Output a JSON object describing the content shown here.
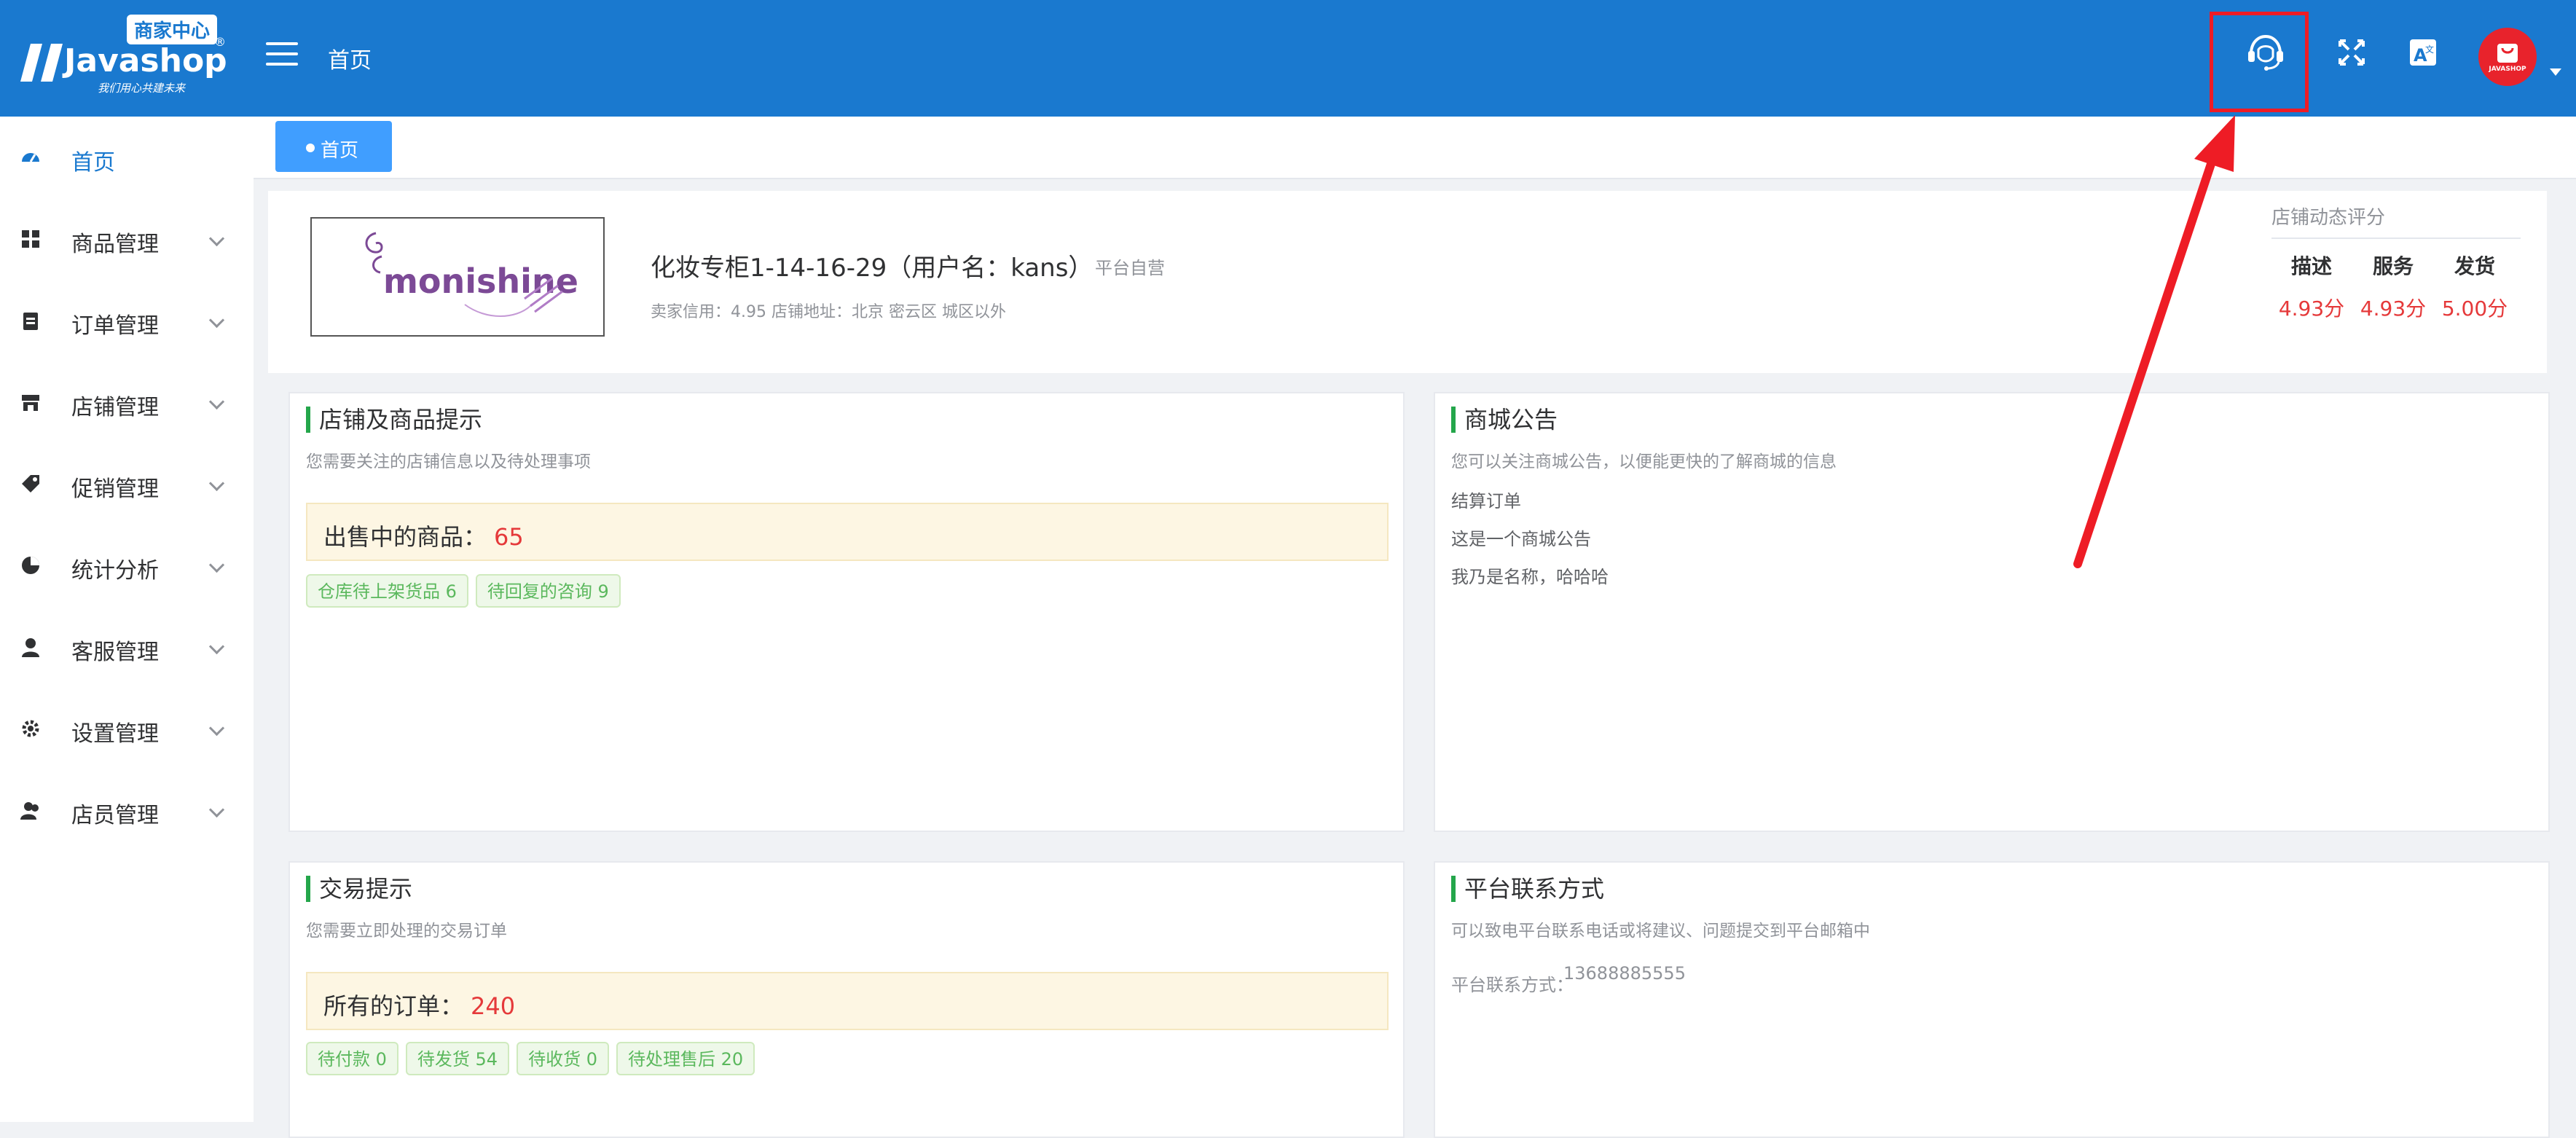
{
  "header": {
    "logo_badge": "商家中心",
    "logo_text": "Javashop",
    "logo_reg": "®",
    "logo_slogan": "我们用心共建未来",
    "title": "首页",
    "avatar_text": "JAVASHOP",
    "icons": [
      "customer-service-icon",
      "fullscreen-icon",
      "translate-icon"
    ],
    "colors": {
      "header_bg": "#1a79cf",
      "highlight": "#ee1c25",
      "avatar_bg": "#e8232c"
    }
  },
  "sidebar": {
    "items": [
      {
        "label": "首页",
        "icon": "dashboard-icon",
        "active": true,
        "expandable": false
      },
      {
        "label": "商品管理",
        "icon": "grid-icon",
        "expandable": true
      },
      {
        "label": "订单管理",
        "icon": "clipboard-icon",
        "expandable": true
      },
      {
        "label": "店铺管理",
        "icon": "store-icon",
        "expandable": true
      },
      {
        "label": "促销管理",
        "icon": "tag-icon",
        "expandable": true
      },
      {
        "label": "统计分析",
        "icon": "pie-chart-icon",
        "expandable": true
      },
      {
        "label": "客服管理",
        "icon": "user-icon",
        "expandable": true
      },
      {
        "label": "设置管理",
        "icon": "gear-icon",
        "expandable": true
      },
      {
        "label": "店员管理",
        "icon": "team-icon",
        "expandable": true
      }
    ]
  },
  "tabs": [
    {
      "label": "首页",
      "active": true
    }
  ],
  "store": {
    "logo_text": "monishine",
    "name": "化妆专柜1-14-16-29（用户名：kans）",
    "self_run": "平台自营",
    "meta": "卖家信用：4.95   店铺地址：北京 密云区 城区以外",
    "rating_title": "店铺动态评分",
    "ratings": [
      {
        "label": "描述",
        "value": "4.93分"
      },
      {
        "label": "服务",
        "value": "4.93分"
      },
      {
        "label": "发货",
        "value": "5.00分"
      }
    ]
  },
  "panels": {
    "goods": {
      "title": "店铺及商品提示",
      "subtitle": "您需要关注的店铺信息以及待处理事项",
      "stat_label": "出售中的商品：",
      "stat_value": "65",
      "tags": [
        "仓库待上架货品 6",
        "待回复的咨询 9"
      ]
    },
    "notice": {
      "title": "商城公告",
      "subtitle": "您可以关注商城公告，以便能更快的了解商城的信息",
      "items": [
        "结算订单",
        "这是一个商城公告",
        "我乃是名称，哈哈哈"
      ]
    },
    "trade": {
      "title": "交易提示",
      "subtitle": "您需要立即处理的交易订单",
      "stat_label": "所有的订单：",
      "stat_value": "240",
      "tags": [
        "待付款 0",
        "待发货 54",
        "待收货 0",
        "待处理售后 20"
      ]
    },
    "contact": {
      "title": "平台联系方式",
      "subtitle": "可以致电平台联系电话或将建议、问题提交到平台邮箱中",
      "label": "平台联系方式：",
      "value": "13688885555"
    }
  }
}
